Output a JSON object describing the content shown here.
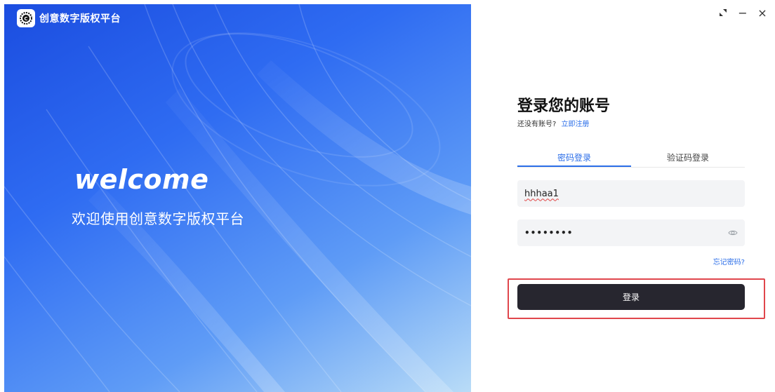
{
  "app": {
    "name": "创意数字版权平台"
  },
  "hero": {
    "welcome": "welcome",
    "subtitle": "欢迎使用创意数字版权平台"
  },
  "window_controls": {
    "restore": "⤡",
    "minimize": "−",
    "close": "×"
  },
  "login": {
    "title": "登录您的账号",
    "no_account_text": "还没有账号?",
    "register_link": "立即注册",
    "tabs": [
      {
        "label": "密码登录",
        "active": true
      },
      {
        "label": "验证码登录",
        "active": false
      }
    ],
    "username_value": "hhhaa1",
    "password_masked": "••••••••",
    "forgot_password": "忘记密码?",
    "submit_label": "登录"
  },
  "colors": {
    "accent": "#2b6ee8",
    "button_bg": "#27262f",
    "highlight_border": "#e0464c"
  }
}
